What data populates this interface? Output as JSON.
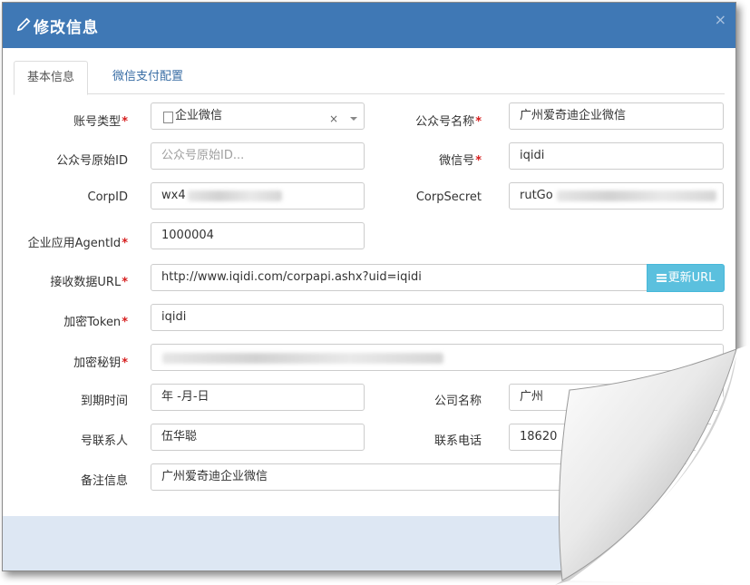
{
  "dialog": {
    "title": "修改信息",
    "close_glyph": "×",
    "icons": {
      "title": "pencil-icon",
      "close": "close-icon",
      "select": "document-icon",
      "button": "list-icon"
    }
  },
  "tabs": [
    {
      "label": "基本信息",
      "active": true
    },
    {
      "label": "微信支付配置",
      "active": false
    }
  ],
  "form": {
    "account_type": {
      "label": "账号类型",
      "required": true,
      "value": "企业微信",
      "clear_glyph": "×"
    },
    "public_name": {
      "label": "公众号名称",
      "required": true,
      "value": "广州爱奇迪企业微信"
    },
    "original_id": {
      "label": "公众号原始ID",
      "required": false,
      "value": "",
      "placeholder": "公众号原始ID..."
    },
    "wechat_id": {
      "label": "微信号",
      "required": true,
      "value": "iqidi"
    },
    "corp_id": {
      "label": "CorpID",
      "required": false,
      "value": "wx4"
    },
    "corp_secret": {
      "label": "CorpSecret",
      "required": false,
      "value": "rutGo"
    },
    "agent_id": {
      "label": "企业应用AgentId",
      "required": true,
      "value": "1000004"
    },
    "receive_url": {
      "label": "接收数据URL",
      "required": true,
      "value": "http://www.iqidi.com/corpapi.ashx?uid=iqidi",
      "button": "更新URL"
    },
    "token": {
      "label": "加密Token",
      "required": true,
      "value": "iqidi"
    },
    "aes_key": {
      "label": "加密秘钥",
      "required": true,
      "value": ""
    },
    "expire_date": {
      "label": "到期时间",
      "required": false,
      "value": "年 -月-日"
    },
    "company_name": {
      "label": "公司名称",
      "required": false,
      "value": "广州"
    },
    "contact": {
      "label": "号联系人",
      "required": false,
      "value": "伍华聪"
    },
    "phone": {
      "label": "联系电话",
      "required": false,
      "value": "18620"
    },
    "note": {
      "label": "备注信息",
      "required": false,
      "value": "广州爱奇迪企业微信"
    }
  },
  "colors": {
    "header": "#3f78b5",
    "footer": "#dde7f3",
    "button": "#5bc0de",
    "required": "#d61e1e"
  }
}
